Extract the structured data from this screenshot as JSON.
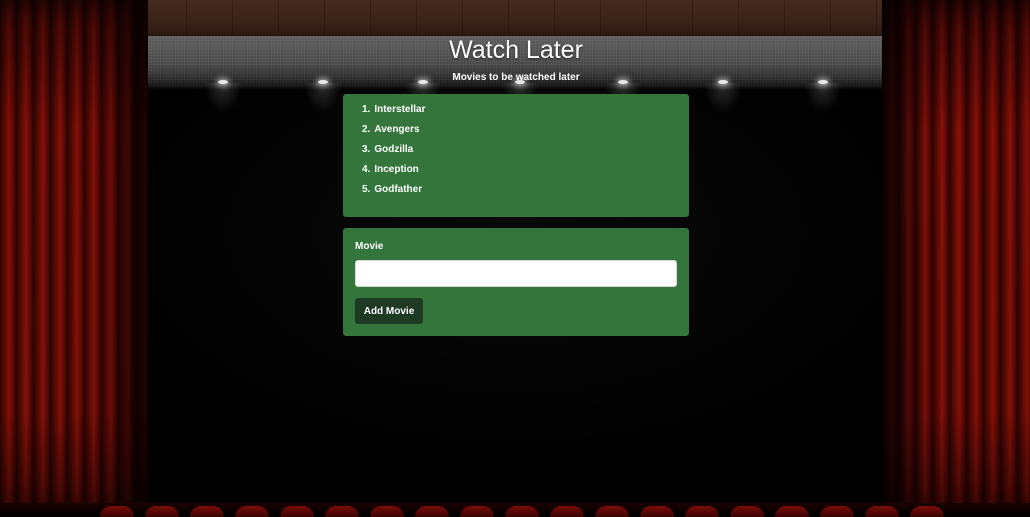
{
  "header": {
    "title": "Watch Later",
    "subtitle": "Movies to be watched later"
  },
  "movies": [
    {
      "number": "1.",
      "title": "Interstellar"
    },
    {
      "number": "2.",
      "title": "Avengers"
    },
    {
      "number": "3.",
      "title": "Godzilla"
    },
    {
      "number": "4.",
      "title": "Inception"
    },
    {
      "number": "5.",
      "title": "Godfather"
    }
  ],
  "form": {
    "label": "Movie",
    "input_value": "",
    "input_placeholder": "",
    "add_button_label": "Add Movie"
  },
  "colors": {
    "panel": "#33753a",
    "button": "#1f3a22",
    "curtain": "#8a1209",
    "text": "#ffffff"
  }
}
